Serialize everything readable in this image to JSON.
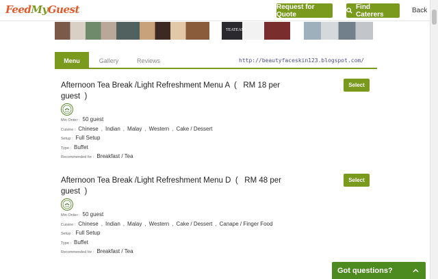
{
  "header": {
    "logo_part1": "Feed",
    "logo_part2": "My",
    "logo_part3": "Guest",
    "quote_button": "Request for Quote",
    "caterers_button": "Find Caterers",
    "caterers_icon": "search-icon",
    "back_link": "Back"
  },
  "gallery_strip": {
    "caption3": "TEATEAM"
  },
  "tabs": [
    {
      "label": "Menu",
      "active": true
    },
    {
      "label": "Gallery",
      "active": false
    },
    {
      "label": "Reviews",
      "active": false
    }
  ],
  "blog_url": "http://beautyfaceskin123.blogspot.com/",
  "menu_items": [
    {
      "title": "Afternoon Tea Break /Light Refreshment Menu A",
      "price": "RM 18 per guest",
      "halal_icon": "halal-logo-icon",
      "min_order_label": "Min Order :",
      "min_order": "50 guest",
      "cuisine_label": "Cuisine :",
      "cuisines": [
        "Chinese",
        "Indian",
        "Malay",
        "Western",
        "Cake / Dessert"
      ],
      "setup_label": "Setup :",
      "setup": "Full Setup",
      "type_label": "Type :",
      "type": "Buffet",
      "recommended_label": "Recommended for :",
      "recommended": "Breakfast / Tea",
      "select_label": "Select"
    },
    {
      "title": "Afternoon Tea Break /Light Refreshment Menu D",
      "price": "RM 48 per guest",
      "halal_icon": "halal-logo-icon",
      "min_order_label": "Min Order :",
      "min_order": "50 guest",
      "cuisine_label": "Cuisine :",
      "cuisines": [
        "Chinese",
        "Indian",
        "Malay",
        "Western",
        "Cake / Dessert",
        "Canape / Finger Food"
      ],
      "setup_label": "Setup :",
      "setup": "Full Setup",
      "type_label": "Type :",
      "type": "Buffet",
      "recommended_label": "Recommended for :",
      "recommended": "Breakfast / Tea",
      "select_label": "Select"
    }
  ],
  "chat_widget": {
    "label": "Got questions?",
    "icon": "chevron-up-icon"
  },
  "colors": {
    "accent_green": "#7a9a1e",
    "logo_orange": "#e2592a",
    "chat_green": "#4d8a1f"
  }
}
